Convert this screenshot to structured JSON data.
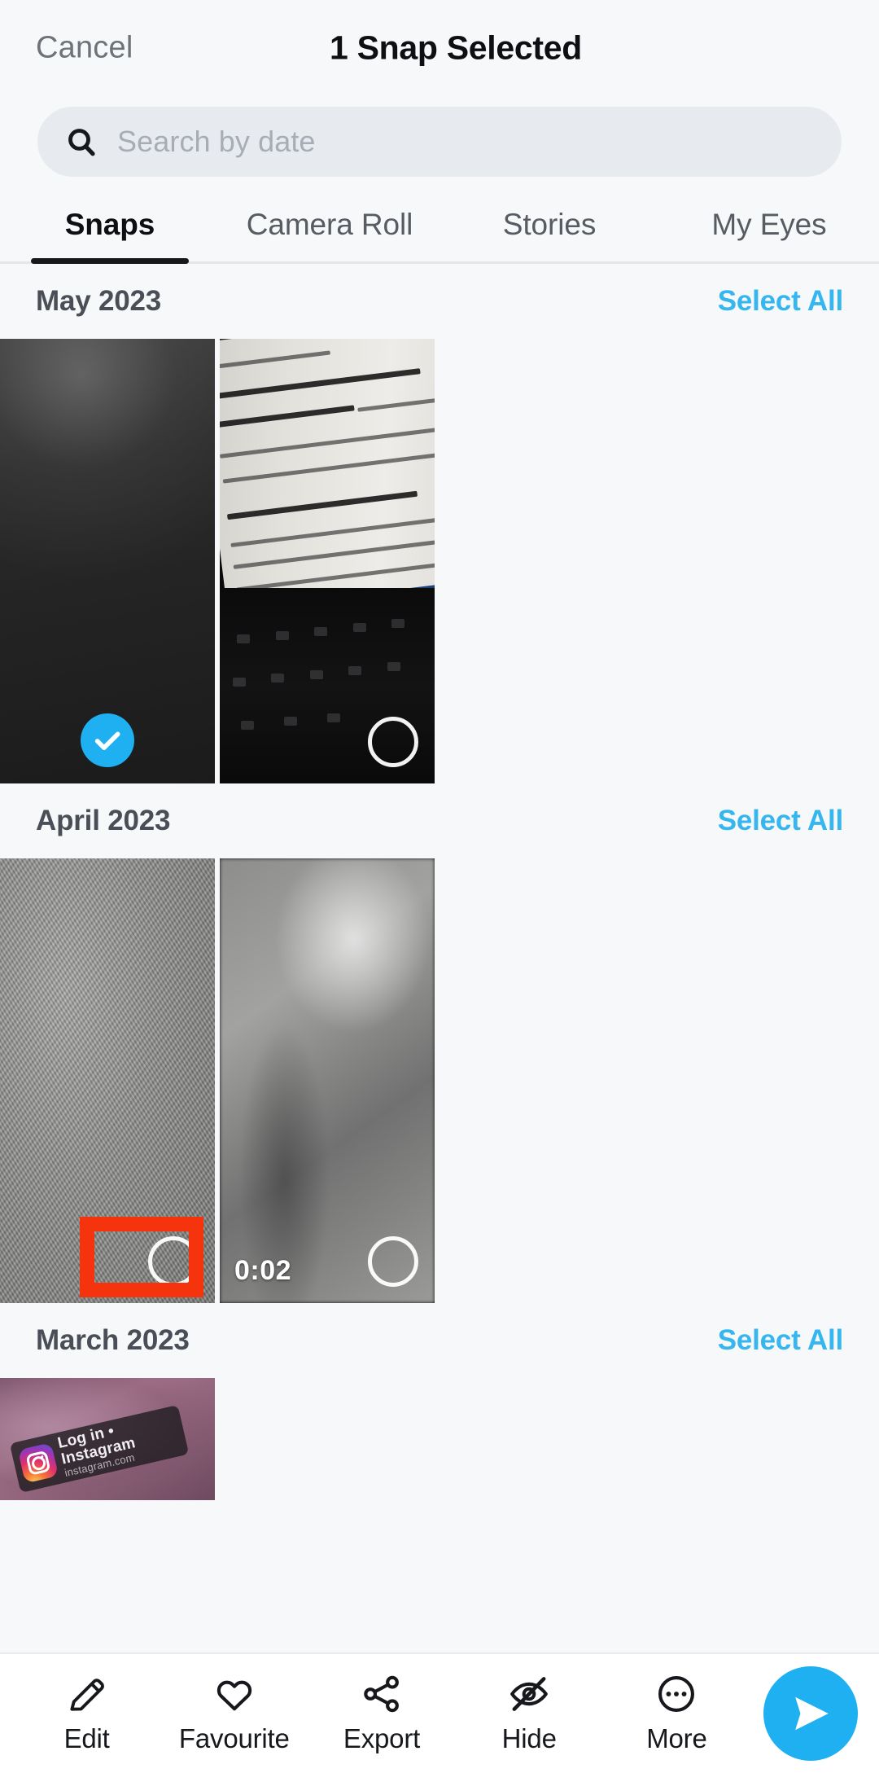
{
  "header": {
    "cancel_label": "Cancel",
    "title": "1 Snap Selected"
  },
  "search": {
    "placeholder": "Search by date",
    "value": "",
    "icon": "search-icon"
  },
  "tabs": [
    {
      "label": "Snaps",
      "active": true
    },
    {
      "label": "Camera Roll",
      "active": false
    },
    {
      "label": "Stories",
      "active": false
    },
    {
      "label": "My Eyes",
      "active": false
    }
  ],
  "sections": [
    {
      "title": "May 2023",
      "select_all_label": "Select All",
      "items": [
        {
          "kind": "photo",
          "selected": true,
          "duration": ""
        },
        {
          "kind": "photo",
          "selected": false,
          "duration": ""
        }
      ]
    },
    {
      "title": "April 2023",
      "select_all_label": "Select All",
      "items": [
        {
          "kind": "photo",
          "selected": false,
          "duration": ""
        },
        {
          "kind": "video",
          "selected": false,
          "duration": "0:02"
        }
      ]
    },
    {
      "title": "March 2023",
      "select_all_label": "Select All",
      "items": [
        {
          "kind": "photo",
          "selected": false,
          "duration": ""
        }
      ]
    }
  ],
  "thumbnail_overlay": {
    "instagram_sticker_title": "Log in • Instagram",
    "instagram_sticker_subtitle": "instagram.com"
  },
  "annotation": {
    "color": "#f5330c",
    "target": "selected-snap-checkmark"
  },
  "toolbar": {
    "items": [
      {
        "label": "Edit",
        "icon": "pencil-icon"
      },
      {
        "label": "Favourite",
        "icon": "heart-icon"
      },
      {
        "label": "Export",
        "icon": "share-icon"
      },
      {
        "label": "Hide",
        "icon": "eye-slash-icon"
      },
      {
        "label": "More",
        "icon": "ellipsis-circle-icon"
      }
    ],
    "send_icon": "send-arrow-icon"
  },
  "colors": {
    "accent_blue": "#1eb0f0",
    "link_blue": "#36b6ef",
    "annotation_red": "#f5330c",
    "page_bg": "#f7f8f9",
    "search_bg": "#e7eaee"
  }
}
